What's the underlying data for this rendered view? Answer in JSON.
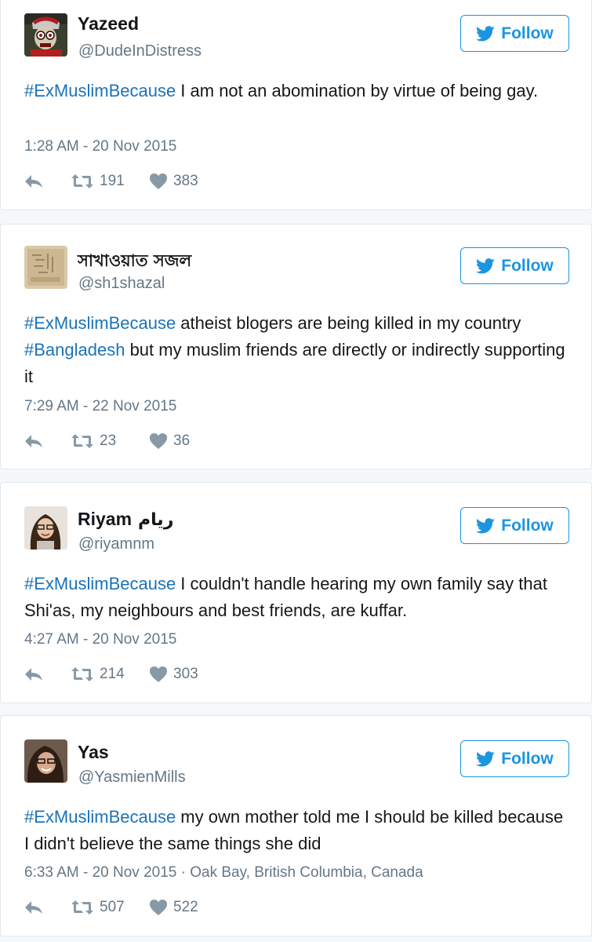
{
  "colors": {
    "link": "#1b73b8",
    "follow_accent": "#1b95e0",
    "secondary_text": "#657786",
    "border": "#e1e8ed"
  },
  "follow_label": "Follow",
  "tweets": [
    {
      "name": "Yazeed",
      "name_extra": "",
      "handle": "@DudeInDistress",
      "segments": [
        {
          "text": "#ExMuslimBecause",
          "hashtag": true
        },
        {
          "text": " I am not an abomination by virtue of being gay.",
          "hashtag": false
        }
      ],
      "timestamp": "1:28 AM - 20 Nov 2015",
      "retweets": "191",
      "likes": "383"
    },
    {
      "name": "সাখাওয়াত সজল",
      "name_extra": "",
      "handle": "@sh1shazal",
      "segments": [
        {
          "text": "#ExMuslimBecause",
          "hashtag": true
        },
        {
          "text": " atheist blogers are being killed in my country ",
          "hashtag": false
        },
        {
          "text": "#Bangladesh",
          "hashtag": true
        },
        {
          "text": " but my muslim friends are directly or indirectly supporting it",
          "hashtag": false
        }
      ],
      "timestamp": "7:29 AM - 22 Nov 2015",
      "retweets": "23",
      "likes": "36"
    },
    {
      "name": "Riyam",
      "name_extra": "ريام",
      "handle": "@riyamnm",
      "segments": [
        {
          "text": "#ExMuslimBecause",
          "hashtag": true
        },
        {
          "text": " I couldn't handle hearing my own family say that Shi'as, my neighbours and best friends, are kuffar.",
          "hashtag": false
        }
      ],
      "timestamp": "4:27 AM - 20 Nov 2015",
      "retweets": "214",
      "likes": "303"
    },
    {
      "name": "Yas",
      "name_extra": "",
      "handle": "@YasmienMills",
      "segments": [
        {
          "text": "#ExMuslimBecause",
          "hashtag": true
        },
        {
          "text": " my own mother told me I should be killed because I didn't believe the same things she did",
          "hashtag": false
        }
      ],
      "timestamp": "6:33 AM - 20 Nov 2015 · Oak Bay, British Columbia, Canada",
      "retweets": "507",
      "likes": "522"
    }
  ]
}
